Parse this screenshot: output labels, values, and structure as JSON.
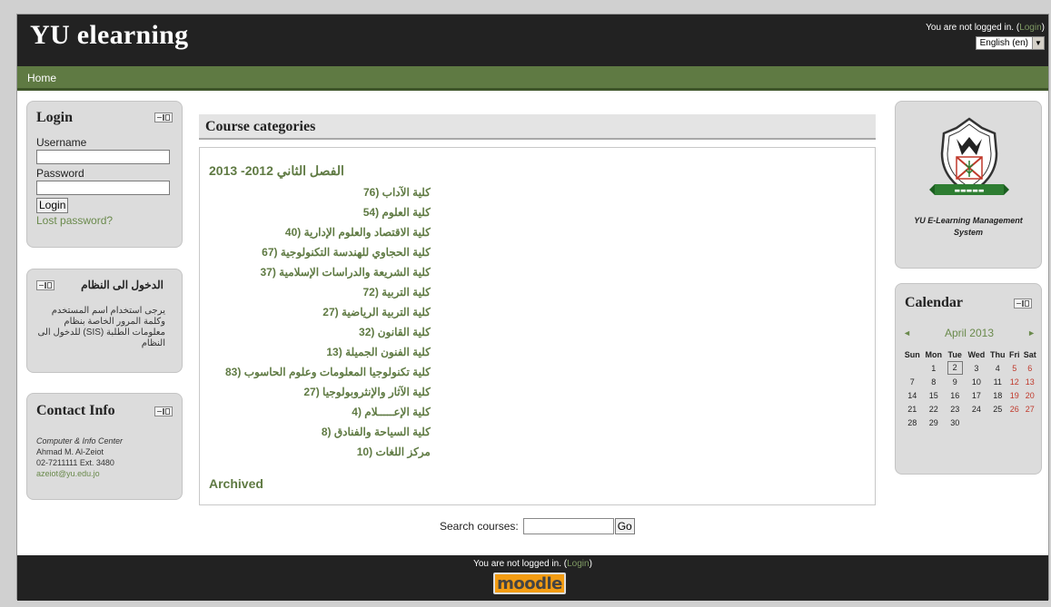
{
  "header": {
    "site_title": "YU elearning",
    "login_status": "You are not logged in. (",
    "login_link": "Login",
    "login_close": ")",
    "language": "English (en)"
  },
  "nav": {
    "home": "Home"
  },
  "login_block": {
    "title": "Login",
    "username_label": "Username",
    "password_label": "Password",
    "login_button": "Login",
    "lost_password": "Lost password?"
  },
  "arabic_block": {
    "title": "الدخول الى النظام",
    "body": "يرجى استخدام اسم المستخدم وكلمة المرور الخاصة بنظام معلومات الطلبة (SIS) للدخول الى النظام"
  },
  "contact_block": {
    "title": "Contact Info",
    "line1": "Computer & Info Center",
    "line2": "Ahmad M. Al-Zeiot",
    "line3": "02-7211111 Ext. 3480",
    "email": "azeiot@yu.edu.jo"
  },
  "main": {
    "categories_heading": "Course categories",
    "main_category": "الفصل الثاني 2012- 2013",
    "subcategories": [
      "كلية الآداب (76",
      "كلية العلوم (54",
      "كلية الاقتصاد والعلوم الإدارية (40",
      "كلية الحجاوي للهندسة التكنولوجية (67",
      "كلية الشريعة والدراسات الإسلامية (37",
      "كلية التربية (72",
      "كلية التربية الرياضية (27",
      "كلية القانون (32",
      "كلية الفنون الجميلة (13",
      "كلية تكنولوجيا المعلومات وعلوم الحاسوب (83",
      "كلية الآثار والإنثروبولوجيا (27",
      "كلية الإعـــــلام (4",
      "كلية السياحة والفنادق (8",
      "مركز اللغات (10"
    ],
    "archived": "Archived",
    "search_label": "Search courses:",
    "go_button": "Go"
  },
  "logo_block": {
    "caption_line1": "YU E-Learning Management",
    "caption_line2": "System"
  },
  "calendar": {
    "title": "Calendar",
    "month": "April 2013",
    "prev": "◄",
    "next": "►",
    "days": [
      "Sun",
      "Mon",
      "Tue",
      "Wed",
      "Thu",
      "Fri",
      "Sat"
    ],
    "weeks": [
      [
        "",
        "1",
        "2",
        "3",
        "4",
        "5",
        "6"
      ],
      [
        "7",
        "8",
        "9",
        "10",
        "11",
        "12",
        "13"
      ],
      [
        "14",
        "15",
        "16",
        "17",
        "18",
        "19",
        "20"
      ],
      [
        "21",
        "22",
        "23",
        "24",
        "25",
        "26",
        "27"
      ],
      [
        "28",
        "29",
        "30",
        "",
        "",
        "",
        ""
      ]
    ],
    "today": "2"
  },
  "footer": {
    "status": "You are not logged in. (",
    "login_link": "Login",
    "close": ")",
    "moodle_text": "moodle"
  },
  "colors": {
    "header_bg": "#222222",
    "nav_bg": "#5f7a43",
    "link_green": "#5f7a43",
    "weekend_red": "#c0392b"
  }
}
